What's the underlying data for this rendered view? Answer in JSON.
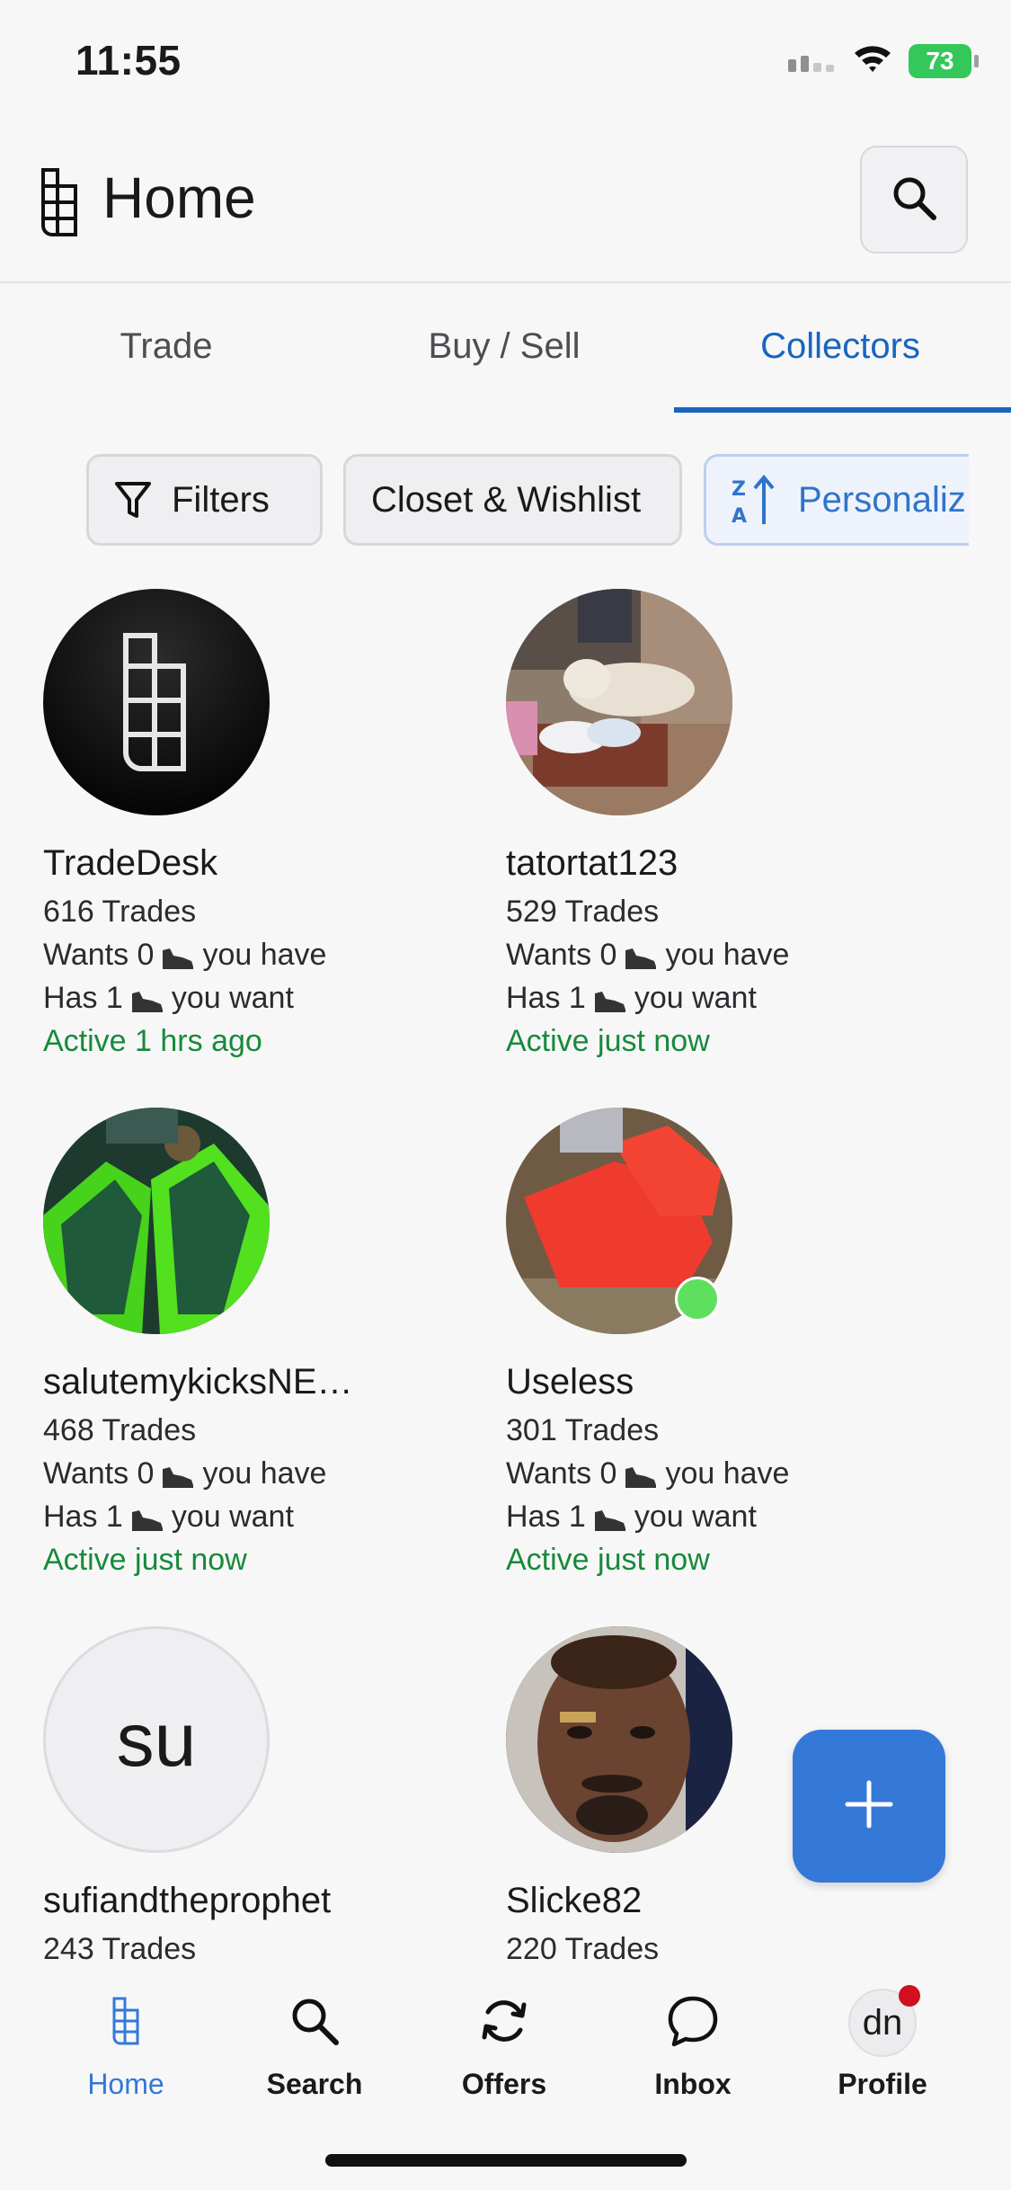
{
  "status_bar": {
    "time": "11:55",
    "battery": "73"
  },
  "header": {
    "title": "Home"
  },
  "tabs": [
    {
      "label": "Trade"
    },
    {
      "label": "Buy / Sell"
    },
    {
      "label": "Collectors"
    }
  ],
  "chips": {
    "filters": "Filters",
    "closet": "Closet & Wishlist",
    "sort": "Personaliz"
  },
  "collectors": [
    {
      "name": "TradeDesk",
      "trades": "616 Trades",
      "wants_prefix": "Wants 0",
      "wants_suffix": "you have",
      "has_prefix": "Has 1",
      "has_suffix": "you want",
      "active": "Active 1 hrs ago"
    },
    {
      "name": "tatortat123",
      "trades": "529 Trades",
      "wants_prefix": "Wants 0",
      "wants_suffix": "you have",
      "has_prefix": "Has 1",
      "has_suffix": "you want",
      "active": "Active just now"
    },
    {
      "name": "salutemykicksNE…",
      "trades": "468 Trades",
      "wants_prefix": "Wants 0",
      "wants_suffix": "you have",
      "has_prefix": "Has 1",
      "has_suffix": "you want",
      "active": "Active just now"
    },
    {
      "name": "Useless",
      "trades": "301 Trades",
      "wants_prefix": "Wants 0",
      "wants_suffix": "you have",
      "has_prefix": "Has 1",
      "has_suffix": "you want",
      "active": "Active just now"
    },
    {
      "name": "sufiandtheprophet",
      "trades": "243 Trades",
      "avatar_initials": "su"
    },
    {
      "name": "Slicke82",
      "trades": "220 Trades"
    }
  ],
  "bottom_nav": [
    {
      "label": "Home"
    },
    {
      "label": "Search"
    },
    {
      "label": "Offers"
    },
    {
      "label": "Inbox"
    },
    {
      "label": "Profile",
      "initials": "dn"
    }
  ],
  "colors": {
    "accent": "#1765c0",
    "active_green": "#178a3a",
    "fab": "#3478d8",
    "battery": "#34c759",
    "online": "#5ee05e",
    "notification": "#d10f1e"
  }
}
